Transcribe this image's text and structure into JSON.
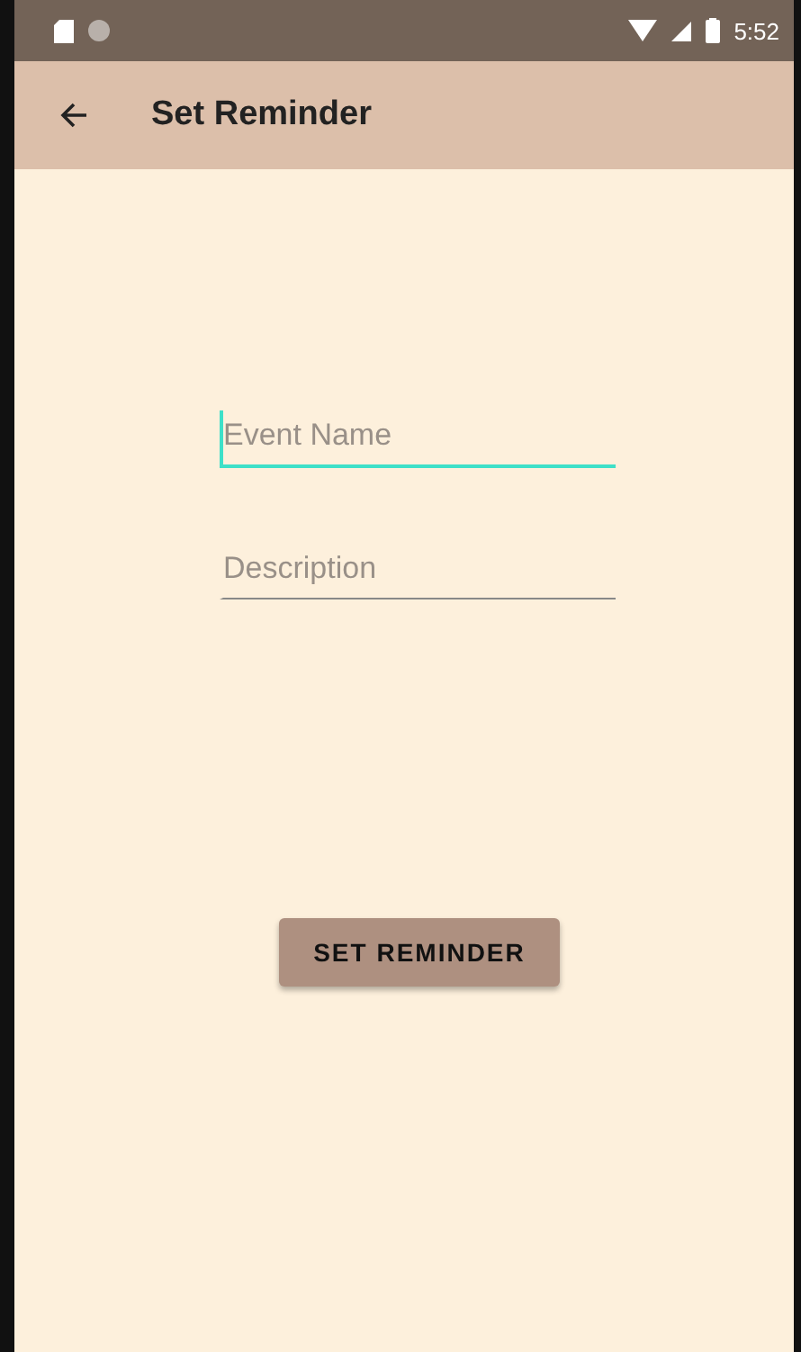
{
  "status_bar": {
    "time": "5:52"
  },
  "app_bar": {
    "title": "Set Reminder"
  },
  "fields": [
    {
      "placeholder": "Event Name",
      "focused": true
    },
    {
      "placeholder": "Description",
      "focused": false
    }
  ],
  "button": {
    "label": "SET REMINDER"
  }
}
